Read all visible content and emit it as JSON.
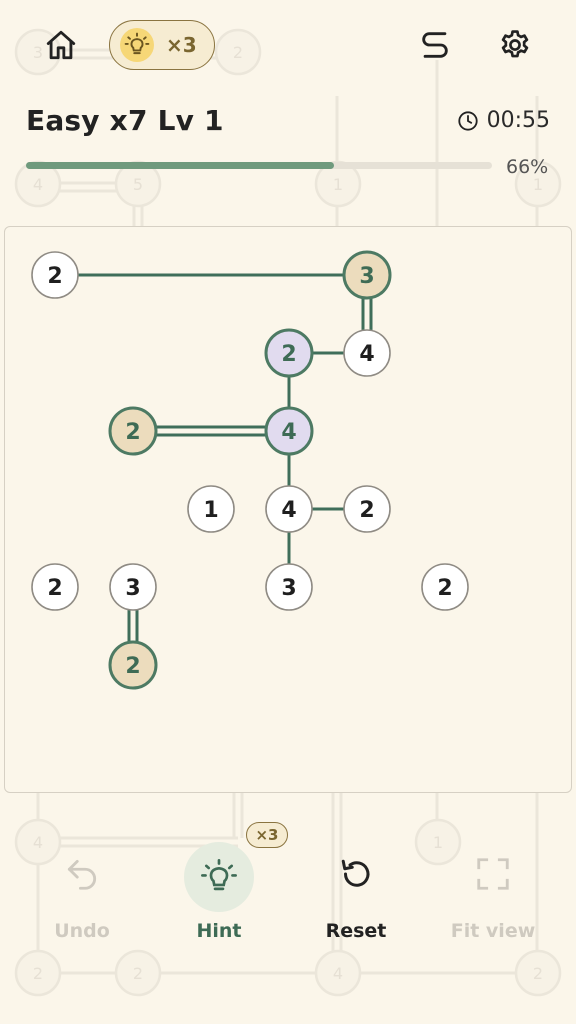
{
  "header": {
    "hint_count": "×3",
    "level_title": "Easy x7 Lv 1",
    "timer": "00:55",
    "progress_label": "66%",
    "progress_value": 0.66
  },
  "icons": {
    "home": "home-icon",
    "hint": "lightbulb-icon",
    "solver": "path-icon",
    "settings": "gear-icon",
    "clock": "clock-icon",
    "undo": "undo-icon",
    "reset": "reset-icon",
    "fit": "fit-view-icon"
  },
  "colors": {
    "accent": "#4d7a63",
    "bridge": "#3f6e5a",
    "complete_fill": "#ecdcbd",
    "selected_fill": "#e1dbef",
    "node_fill": "#ffffff"
  },
  "board": {
    "nodes": [
      {
        "id": "n1",
        "row": 0,
        "col": 0,
        "value": "2",
        "state": "normal"
      },
      {
        "id": "n2",
        "row": 0,
        "col": 4,
        "value": "3",
        "state": "complete"
      },
      {
        "id": "n3",
        "row": 1,
        "col": 3,
        "value": "2",
        "state": "selected"
      },
      {
        "id": "n4",
        "row": 1,
        "col": 4,
        "value": "4",
        "state": "normal"
      },
      {
        "id": "n5",
        "row": 2,
        "col": 1,
        "value": "2",
        "state": "complete"
      },
      {
        "id": "n6",
        "row": 2,
        "col": 3,
        "value": "4",
        "state": "selected"
      },
      {
        "id": "n7",
        "row": 3,
        "col": 2,
        "value": "1",
        "state": "normal"
      },
      {
        "id": "n8",
        "row": 3,
        "col": 3,
        "value": "4",
        "state": "normal"
      },
      {
        "id": "n9",
        "row": 3,
        "col": 4,
        "value": "2",
        "state": "normal"
      },
      {
        "id": "n10",
        "row": 4,
        "col": 0,
        "value": "2",
        "state": "normal"
      },
      {
        "id": "n11",
        "row": 4,
        "col": 1,
        "value": "3",
        "state": "normal"
      },
      {
        "id": "n12",
        "row": 4,
        "col": 3,
        "value": "3",
        "state": "normal"
      },
      {
        "id": "n13",
        "row": 4,
        "col": 5,
        "value": "2",
        "state": "normal"
      },
      {
        "id": "n14",
        "row": 5,
        "col": 1,
        "value": "2",
        "state": "complete"
      }
    ],
    "bridges": [
      {
        "from": "n1",
        "to": "n2",
        "count": 1
      },
      {
        "from": "n2",
        "to": "n4",
        "count": 2
      },
      {
        "from": "n3",
        "to": "n4",
        "count": 1
      },
      {
        "from": "n3",
        "to": "n6",
        "count": 1
      },
      {
        "from": "n5",
        "to": "n6",
        "count": 2
      },
      {
        "from": "n6",
        "to": "n8",
        "count": 1
      },
      {
        "from": "n8",
        "to": "n9",
        "count": 1
      },
      {
        "from": "n8",
        "to": "n12",
        "count": 1
      },
      {
        "from": "n11",
        "to": "n14",
        "count": 2
      }
    ]
  },
  "bottom": {
    "undo_label": "Undo",
    "hint_label": "Hint",
    "hint_badge": "×3",
    "reset_label": "Reset",
    "fit_label": "Fit view"
  },
  "background_nodes": [
    "3",
    "2",
    "4",
    "5",
    "1",
    "1",
    "4",
    "1",
    "2",
    "2",
    "4",
    "2"
  ]
}
